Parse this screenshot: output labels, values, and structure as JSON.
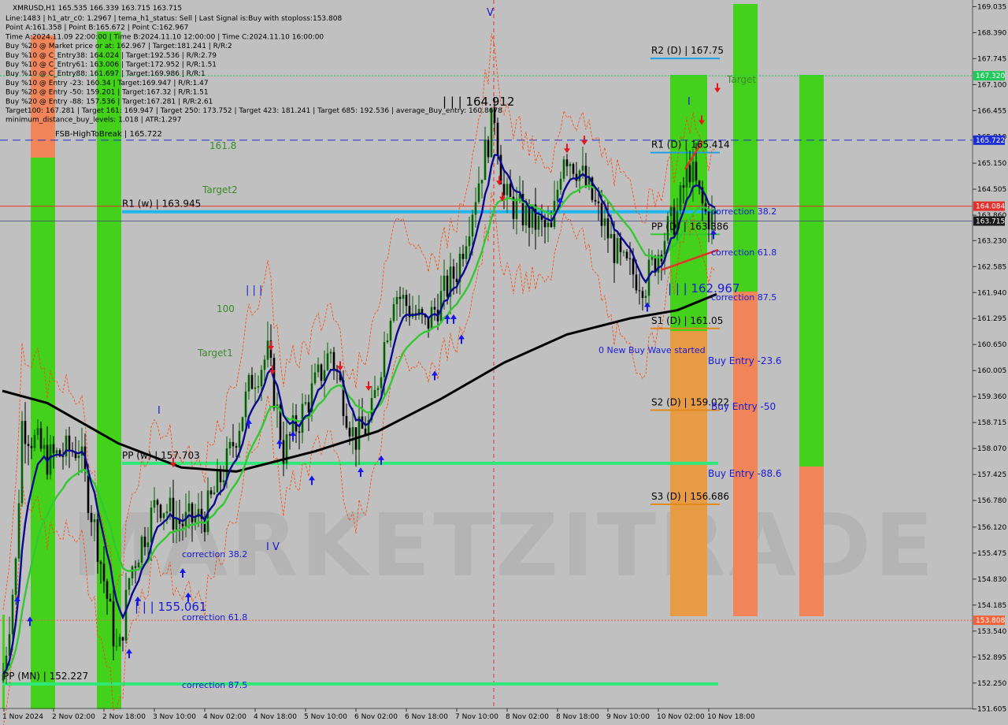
{
  "header": {
    "symbol_line": "XMRUSD,H1  165.535 166.339 163.715 163.715",
    "lines": [
      "Line:1483 | h1_atr_c0: 1.2967 | tema_h1_status: Sell | Last Signal is:Buy with stoploss:153.808",
      "Point A:161.358 | Point B:165.672 | Point C:162.967",
      "Time A:2024.11.09 22:00:00 | Time B:2024.11.10 12:00:00 | Time C:2024.11.10 16:00:00",
      "Buy %20 @ Market price or at: 162.967 | Target:181.241 | R/R:2",
      "Buy %10 @ C_Entry38: 164.024 | Target:192.536 | R/R:2.79",
      "Buy %10 @ C_Entry61: 163.006 | Target:172.952 | R/R:1.51",
      "Buy %10 @ C_Entry88: 161.697 | Target:169.986 | R/R:1",
      "Buy %10 @ Entry -23: 160.34 | Target:169.947 | R/R:1.47",
      "Buy %20 @ Entry -50: 159.201 | Target:167.32 | R/R:1.51",
      "Buy %20 @ Entry -88: 157.536 | Target:167.281 | R/R:2.61",
      "Target100: 167.281 | Target 161: 169.947 | Target 250: 173.752 | Target 423: 181.241 | Target 685: 192.536 | average_Buy_entry: 160.8678",
      "minimum_distance_buy_levels: 1.018 | ATR:1.297"
    ]
  },
  "watermark": "MARKETZITRADE",
  "chart_data": {
    "type": "candlestick",
    "symbol": "XMRUSD",
    "timeframe": "H1",
    "ylim": [
      151.6,
      169.2
    ],
    "y_ticks": [
      "169.035",
      "168.390",
      "167.745",
      "167.100",
      "166.455",
      "165.810",
      "165.150",
      "164.505",
      "163.860",
      "163.230",
      "162.585",
      "161.940",
      "161.295",
      "160.650",
      "160.005",
      "159.360",
      "158.715",
      "158.070",
      "157.425",
      "156.780",
      "156.120",
      "155.475",
      "154.830",
      "154.185",
      "153.540",
      "152.895",
      "152.250",
      "151.605"
    ],
    "x_ticks": [
      "1 Nov 2024",
      "2 Nov 02:00",
      "2 Nov 18:00",
      "3 Nov 10:00",
      "4 Nov 02:00",
      "4 Nov 18:00",
      "5 Nov 10:00",
      "6 Nov 02:00",
      "6 Nov 18:00",
      "7 Nov 10:00",
      "8 Nov 02:00",
      "8 Nov 18:00",
      "9 Nov 10:00",
      "10 Nov 02:00",
      "10 Nov 18:00"
    ],
    "price_tags": [
      {
        "text": "167.320",
        "price": 167.32,
        "bg": "#21c85a",
        "fg": "#ffffff"
      },
      {
        "text": "165.722",
        "price": 165.722,
        "bg": "#1c2fd4",
        "fg": "#ffffff"
      },
      {
        "text": "164.084",
        "price": 164.084,
        "bg": "#e5312b",
        "fg": "#ffffff"
      },
      {
        "text": "163.715",
        "price": 163.715,
        "bg": "#1a1a1a",
        "fg": "#ffffff"
      },
      {
        "text": "153.808",
        "price": 153.808,
        "bg": "#f0643c",
        "fg": "#ffffff"
      }
    ],
    "levels": [
      {
        "label": "R2 (D) | 167.75",
        "price": 167.75,
        "color": "#1f9fe6"
      },
      {
        "label": "R1 (D) | 165.414",
        "price": 165.414,
        "color": "#1f9fe6"
      },
      {
        "label": "PP (D) | 163.386",
        "price": 163.386,
        "color": "#1f9fe6"
      },
      {
        "label": "S1 (D) | 161.05",
        "price": 161.05,
        "color": "#e08a1c"
      },
      {
        "label": "S2 (D) | 159.022",
        "price": 159.022,
        "color": "#e08a1c"
      },
      {
        "label": "S3 (D) | 156.686",
        "price": 156.686,
        "color": "#e08a1c"
      },
      {
        "label": "R1 (w) | 163.945",
        "price": 163.945,
        "color": "#1fb6f0"
      },
      {
        "label": "PP (w) | 157.703",
        "price": 157.703,
        "color": "#2ee87a"
      },
      {
        "label": "PP (MN) | 152.227",
        "price": 152.227,
        "color": "#2ee87a"
      }
    ],
    "labels": {
      "fsb": "FSB-HighToBreak | 165.722",
      "wave_c": "| | | 162.967",
      "wave_b": "| | | 164.912",
      "wave_a": "| | | 155.061",
      "new_wave": "0 New Buy Wave started",
      "target1": "Target1",
      "target2": "Target2",
      "target_100": "100",
      "target_161": "161.8",
      "target_top": "Target",
      "corr_38_right": "correction 38.2",
      "corr_61_right": "correction 61.8",
      "corr_87_right": "correction 87.5",
      "corr_38_left": "correction 38.2",
      "corr_61_left": "correction 61.8",
      "corr_87_left": "correction 87.5",
      "buy_entry_23": "Buy Entry -23.6",
      "buy_entry_50": "Buy Entry -50",
      "buy_entry_88": "Buy Entry -88.6",
      "roman_iii": "| | |",
      "roman_iv": "I V",
      "roman_i_1": "I",
      "roman_i_2": "I",
      "roman_v": "V"
    },
    "colors": {
      "bg": "#c0c0c0",
      "bull_candle": "#006400",
      "bear_candle": "#000000",
      "ema_fast": "#0a0a8c",
      "ema_mid": "#32c832",
      "ema_slow": "#000000",
      "envelope": "#ff4500"
    }
  }
}
